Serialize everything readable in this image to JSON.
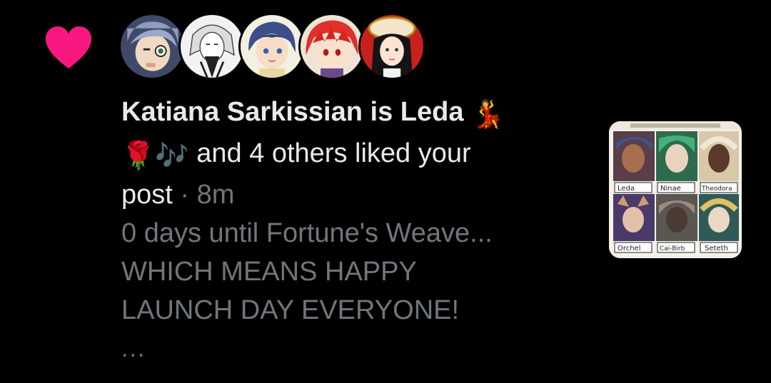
{
  "notification": {
    "type_icon": "heart-icon",
    "accent_color": "#f91880",
    "actor_name": "Katiana Sarkissian is Leda",
    "actor_emoji": "💃",
    "emoji_line": "🌹🎶",
    "action_text": " and 4 others liked your",
    "action_text_2": "post",
    "separator": " · ",
    "time": "8m",
    "post_preview": {
      "line1": "0 days until Fortune's Weave...",
      "line2": "WHICH MEANS HAPPY",
      "line3": "LAUNCH DAY EVERYONE!"
    },
    "ellipsis": "...",
    "thumbnail_labels": [
      "Leda",
      "Ninae",
      "Theodora",
      "Orchel",
      "Cai-Birb",
      "Seteth"
    ],
    "avatars": [
      {
        "name": "avatar-1",
        "bg": "#9aa7c7"
      },
      {
        "name": "avatar-2",
        "bg": "#e8e8e8"
      },
      {
        "name": "avatar-3",
        "bg": "#f3efe2"
      },
      {
        "name": "avatar-4",
        "bg": "#f0e6d8"
      },
      {
        "name": "avatar-5",
        "bg": "#c8201c"
      }
    ]
  }
}
